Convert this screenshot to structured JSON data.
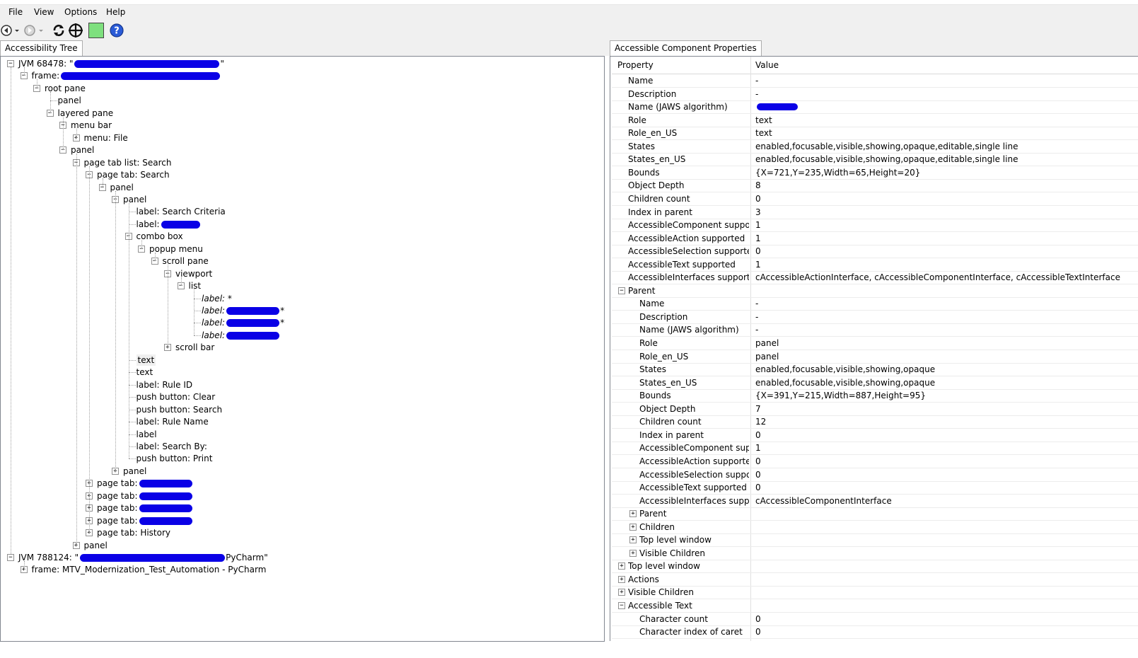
{
  "menu": {
    "items": [
      "File",
      "View",
      "Options",
      "Help"
    ]
  },
  "toolbar": {
    "icons": [
      "back-icon",
      "back-dropdown-icon",
      "forward-icon",
      "forward-dropdown-icon",
      "refresh-icon",
      "crosshair-icon",
      "highlight-color-swatch",
      "help-icon"
    ],
    "swatch_color": "#7ee07e",
    "help_color": "#2a5bd7"
  },
  "left_tab": {
    "label": "Accessibility Tree"
  },
  "right_tab": {
    "label": "Accessible Component Properties"
  },
  "tree": [
    {
      "depth": 0,
      "exp": "-",
      "label": "JVM 68478: \"",
      "tail": "\"",
      "redact": true
    },
    {
      "depth": 1,
      "exp": "-",
      "label": "frame: ",
      "redact": true
    },
    {
      "depth": 2,
      "exp": "-",
      "label": "root pane"
    },
    {
      "depth": 3,
      "exp": "",
      "label": "panel"
    },
    {
      "depth": 3,
      "exp": "-",
      "label": "layered pane"
    },
    {
      "depth": 4,
      "exp": "-",
      "label": "menu bar"
    },
    {
      "depth": 5,
      "exp": "+",
      "label": "menu: File"
    },
    {
      "depth": 4,
      "exp": "-",
      "label": "panel"
    },
    {
      "depth": 5,
      "exp": "-",
      "label": "page tab list: Search"
    },
    {
      "depth": 6,
      "exp": "-",
      "label": "page tab: Search"
    },
    {
      "depth": 7,
      "exp": "-",
      "label": "panel"
    },
    {
      "depth": 8,
      "exp": "-",
      "label": "panel"
    },
    {
      "depth": 9,
      "exp": "",
      "label": "label: Search Criteria"
    },
    {
      "depth": 9,
      "exp": "",
      "label": "label: ",
      "redact": true
    },
    {
      "depth": 9,
      "exp": "-",
      "label": "combo box"
    },
    {
      "depth": 10,
      "exp": "-",
      "label": "popup menu"
    },
    {
      "depth": 11,
      "exp": "-",
      "label": "scroll pane"
    },
    {
      "depth": 12,
      "exp": "-",
      "label": "viewport"
    },
    {
      "depth": 13,
      "exp": "-",
      "label": "list"
    },
    {
      "depth": 14,
      "exp": "",
      "label": "label: *",
      "italic": true
    },
    {
      "depth": 14,
      "exp": "",
      "label": "label: ",
      "tail": "*",
      "italic": true,
      "redact": true
    },
    {
      "depth": 14,
      "exp": "",
      "label": "label: ",
      "tail": "*",
      "italic": true,
      "redact": true
    },
    {
      "depth": 14,
      "exp": "",
      "label": "label: ",
      "italic": true,
      "redact": true
    },
    {
      "depth": 12,
      "exp": "+",
      "label": "scroll bar"
    },
    {
      "depth": 9,
      "exp": "",
      "label": "text",
      "selected": true
    },
    {
      "depth": 9,
      "exp": "",
      "label": "text"
    },
    {
      "depth": 9,
      "exp": "",
      "label": "label: Rule ID"
    },
    {
      "depth": 9,
      "exp": "",
      "label": "push button: Clear"
    },
    {
      "depth": 9,
      "exp": "",
      "label": "push button: Search"
    },
    {
      "depth": 9,
      "exp": "",
      "label": "label: Rule Name"
    },
    {
      "depth": 9,
      "exp": "",
      "label": "label"
    },
    {
      "depth": 9,
      "exp": "",
      "label": "label: Search By:"
    },
    {
      "depth": 9,
      "exp": "",
      "label": "push button: Print"
    },
    {
      "depth": 8,
      "exp": "+",
      "label": "panel"
    },
    {
      "depth": 6,
      "exp": "+",
      "label": "page tab: ",
      "redact": true
    },
    {
      "depth": 6,
      "exp": "+",
      "label": "page tab: ",
      "redact": true
    },
    {
      "depth": 6,
      "exp": "+",
      "label": "page tab: ",
      "redact": true
    },
    {
      "depth": 6,
      "exp": "+",
      "label": "page tab: ",
      "redact": true
    },
    {
      "depth": 6,
      "exp": "+",
      "label": "page tab: History"
    },
    {
      "depth": 5,
      "exp": "+",
      "label": "panel"
    },
    {
      "depth": 0,
      "exp": "-",
      "label": "JVM 788124: \"",
      "tail": "PyCharm\"",
      "redact": true
    },
    {
      "depth": 1,
      "exp": "+",
      "label": "frame: MTV_Modernization_Test_Automation - PyCharm"
    }
  ],
  "grid": {
    "header": {
      "property": "Property",
      "value": "Value"
    },
    "rows": [
      {
        "lvl": 1,
        "exp": "",
        "prop": "Name",
        "val": "-"
      },
      {
        "lvl": 1,
        "exp": "",
        "prop": "Description",
        "val": "-"
      },
      {
        "lvl": 1,
        "exp": "",
        "prop": "Name (JAWS algorithm)",
        "val": "",
        "redact": true
      },
      {
        "lvl": 1,
        "exp": "",
        "prop": "Role",
        "val": "text"
      },
      {
        "lvl": 1,
        "exp": "",
        "prop": "Role_en_US",
        "val": "text"
      },
      {
        "lvl": 1,
        "exp": "",
        "prop": "States",
        "val": "enabled,focusable,visible,showing,opaque,editable,single line"
      },
      {
        "lvl": 1,
        "exp": "",
        "prop": "States_en_US",
        "val": "enabled,focusable,visible,showing,opaque,editable,single line"
      },
      {
        "lvl": 1,
        "exp": "",
        "prop": "Bounds",
        "val": "{X=721,Y=235,Width=65,Height=20}"
      },
      {
        "lvl": 1,
        "exp": "",
        "prop": "Object Depth",
        "val": "8"
      },
      {
        "lvl": 1,
        "exp": "",
        "prop": "Children count",
        "val": "0"
      },
      {
        "lvl": 1,
        "exp": "",
        "prop": "Index in parent",
        "val": "3"
      },
      {
        "lvl": 1,
        "exp": "",
        "prop": "AccessibleComponent suppor...",
        "val": "1"
      },
      {
        "lvl": 1,
        "exp": "",
        "prop": "AccessibleAction supported",
        "val": "1"
      },
      {
        "lvl": 1,
        "exp": "",
        "prop": "AccessibleSelection supported",
        "val": "0"
      },
      {
        "lvl": 1,
        "exp": "",
        "prop": "AccessibleText supported",
        "val": "1"
      },
      {
        "lvl": 1,
        "exp": "",
        "prop": "AccessibleInterfaces supported",
        "val": "cAccessibleActionInterface, cAccessibleComponentInterface, cAccessibleTextInterface"
      },
      {
        "lvl": 0,
        "exp": "-",
        "prop": "Parent",
        "val": ""
      },
      {
        "lvl": 2,
        "exp": "",
        "prop": "Name",
        "val": "-"
      },
      {
        "lvl": 2,
        "exp": "",
        "prop": "Description",
        "val": "-"
      },
      {
        "lvl": 2,
        "exp": "",
        "prop": "Name (JAWS algorithm)",
        "val": "-"
      },
      {
        "lvl": 2,
        "exp": "",
        "prop": "Role",
        "val": "panel"
      },
      {
        "lvl": 2,
        "exp": "",
        "prop": "Role_en_US",
        "val": "panel"
      },
      {
        "lvl": 2,
        "exp": "",
        "prop": "States",
        "val": "enabled,focusable,visible,showing,opaque"
      },
      {
        "lvl": 2,
        "exp": "",
        "prop": "States_en_US",
        "val": "enabled,focusable,visible,showing,opaque"
      },
      {
        "lvl": 2,
        "exp": "",
        "prop": "Bounds",
        "val": "{X=391,Y=215,Width=887,Height=95}"
      },
      {
        "lvl": 2,
        "exp": "",
        "prop": "Object Depth",
        "val": "7"
      },
      {
        "lvl": 2,
        "exp": "",
        "prop": "Children count",
        "val": "12"
      },
      {
        "lvl": 2,
        "exp": "",
        "prop": "Index in parent",
        "val": "0"
      },
      {
        "lvl": 2,
        "exp": "",
        "prop": "AccessibleComponent supp...",
        "val": "1"
      },
      {
        "lvl": 2,
        "exp": "",
        "prop": "AccessibleAction supported",
        "val": "0"
      },
      {
        "lvl": 2,
        "exp": "",
        "prop": "AccessibleSelection suppor...",
        "val": "0"
      },
      {
        "lvl": 2,
        "exp": "",
        "prop": "AccessibleText supported",
        "val": "0"
      },
      {
        "lvl": 2,
        "exp": "",
        "prop": "AccessibleInterfaces suppo...",
        "val": "cAccessibleComponentInterface"
      },
      {
        "lvl": 1,
        "exp": "+",
        "prop": "Parent",
        "val": ""
      },
      {
        "lvl": 1,
        "exp": "+",
        "prop": "Children",
        "val": ""
      },
      {
        "lvl": 1,
        "exp": "+",
        "prop": "Top level window",
        "val": ""
      },
      {
        "lvl": 1,
        "exp": "+",
        "prop": "Visible Children",
        "val": ""
      },
      {
        "lvl": 0,
        "exp": "+",
        "prop": "Top level window",
        "val": ""
      },
      {
        "lvl": 0,
        "exp": "+",
        "prop": "Actions",
        "val": ""
      },
      {
        "lvl": 0,
        "exp": "+",
        "prop": "Visible Children",
        "val": ""
      },
      {
        "lvl": 0,
        "exp": "-",
        "prop": "Accessible Text",
        "val": ""
      },
      {
        "lvl": 2,
        "exp": "",
        "prop": "Character count",
        "val": "0"
      },
      {
        "lvl": 2,
        "exp": "",
        "prop": "Character index of caret",
        "val": "0"
      }
    ]
  }
}
